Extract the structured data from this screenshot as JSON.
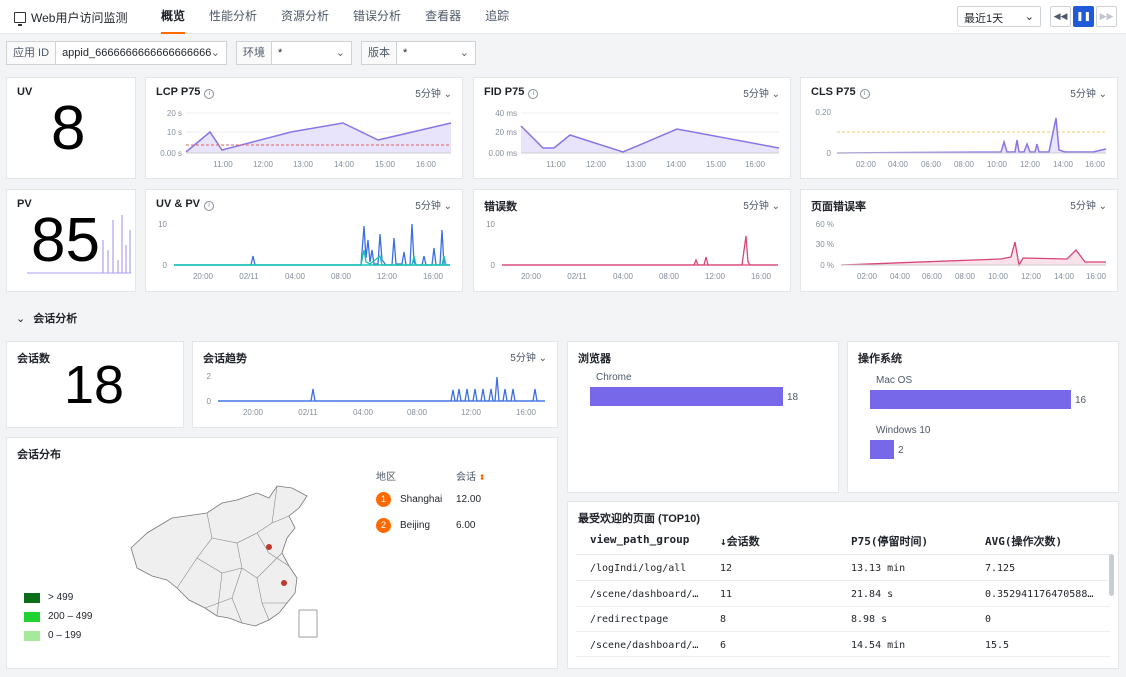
{
  "app": {
    "title": "Web用户访问监测"
  },
  "nav": [
    "概览",
    "性能分析",
    "资源分析",
    "错误分析",
    "查看器",
    "追踪"
  ],
  "time_range": "最近1天",
  "controls": {
    "rewind": "◀◀",
    "pause": "❚❚",
    "forward": "▶▶"
  },
  "filters": [
    {
      "label": "应用 ID",
      "value": "appid_6666666666666666666"
    },
    {
      "label": "环境",
      "value": "*"
    },
    {
      "label": "版本",
      "value": "*"
    }
  ],
  "metrics": {
    "uv": {
      "title": "UV",
      "value": "8"
    },
    "pv": {
      "title": "PV",
      "value": "85"
    },
    "lcp": {
      "title": "LCP P75",
      "interval": "5分钟",
      "yticks": [
        "20 s",
        "10 s",
        "0.00 s"
      ],
      "xticks": [
        "11:00",
        "12:00",
        "13:00",
        "14:00",
        "15:00",
        "16:00"
      ]
    },
    "fid": {
      "title": "FID P75",
      "interval": "5分钟",
      "yticks": [
        "40 ms",
        "20 ms",
        "0.00 ms"
      ],
      "xticks": [
        "11:00",
        "12:00",
        "13:00",
        "14:00",
        "15:00",
        "16:00"
      ]
    },
    "cls": {
      "title": "CLS P75",
      "interval": "5分钟",
      "yticks": [
        "0.20",
        "0"
      ],
      "xticks": [
        "02:00",
        "04:00",
        "06:00",
        "08:00",
        "10:00",
        "12:00",
        "14:00",
        "16:00"
      ]
    },
    "uvpv": {
      "title": "UV & PV",
      "interval": "5分钟",
      "yticks": [
        "10",
        "0"
      ],
      "xticks": [
        "20:00",
        "02/11",
        "04:00",
        "08:00",
        "12:00",
        "16:00"
      ]
    },
    "errors": {
      "title": "错误数",
      "interval": "5分钟",
      "yticks": [
        "10",
        "0"
      ],
      "xticks": [
        "20:00",
        "02/11",
        "04:00",
        "08:00",
        "12:00",
        "16:00"
      ]
    },
    "errrate": {
      "title": "页面错误率",
      "interval": "5分钟",
      "yticks": [
        "60 %",
        "30 %",
        "0 %"
      ],
      "xticks": [
        "02:00",
        "04:00",
        "06:00",
        "08:00",
        "10:00",
        "12:00",
        "14:00",
        "16:00"
      ]
    }
  },
  "session": {
    "section_title": "会话分析",
    "count_title": "会话数",
    "count": "18",
    "trend_title": "会话趋势",
    "trend_interval": "5分钟",
    "trend_yticks": [
      "2",
      "0"
    ],
    "trend_xticks": [
      "20:00",
      "02/11",
      "04:00",
      "08:00",
      "12:00",
      "16:00"
    ],
    "browser_title": "浏览器",
    "browsers": [
      {
        "name": "Chrome",
        "value": 18
      }
    ],
    "os_title": "操作系统",
    "os": [
      {
        "name": "Mac OS",
        "value": 16
      },
      {
        "name": "Windows 10",
        "value": 2
      }
    ],
    "distribution_title": "会话分布",
    "region_header": "地区",
    "session_header": "会话",
    "regions": [
      {
        "rank": "1",
        "name": "Shanghai",
        "value": "12.00"
      },
      {
        "rank": "2",
        "name": "Beijing",
        "value": "6.00"
      }
    ],
    "map_legend": [
      {
        "label": "> 499",
        "color": "#0b6e1a"
      },
      {
        "label": "200 – 499",
        "color": "#1ed12f"
      },
      {
        "label": "0 – 199",
        "color": "#a6e99a"
      }
    ]
  },
  "top_pages": {
    "title": "最受欢迎的页面 (TOP10)",
    "headers": [
      "view_path_group",
      "↓会话数",
      "P75(停留时间)",
      "AVG(操作次数)"
    ],
    "rows": [
      [
        "/logIndi/log/all",
        "12",
        "13.13 min",
        "7.125"
      ],
      [
        "/scene/dashboard/…",
        "11",
        "21.84 s",
        "0.352941176470588…"
      ],
      [
        "/redirectpage",
        "8",
        "8.98 s",
        "0"
      ],
      [
        "/scene/dashboard/…",
        "6",
        "14.54 min",
        "15.5"
      ]
    ]
  }
}
